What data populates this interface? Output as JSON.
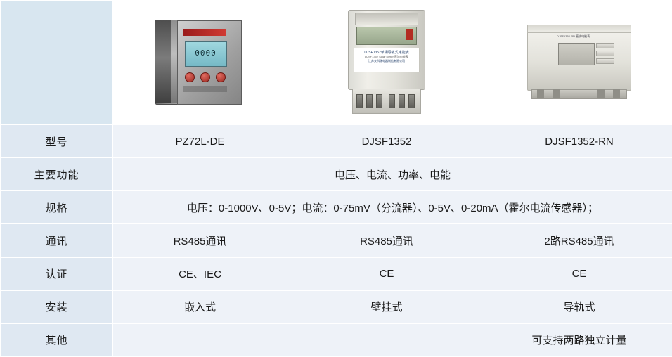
{
  "table": {
    "columns": [
      "",
      "PZ72L-DE",
      "DJSF1352",
      "DJSF1352-RN"
    ],
    "rows": [
      {
        "label": "型号",
        "cells": [
          "PZ72L-DE",
          "DJSF1352",
          "DJSF1352-RN"
        ],
        "span": false,
        "band": "a"
      },
      {
        "label": "主要功能",
        "cells": [
          "电压、电流、功率、电能"
        ],
        "span": true,
        "band": "b"
      },
      {
        "label": "规格",
        "cells": [
          "电压：0-1000V、0-5V；电流：0-75mV（分流器）、0-5V、0-20mA（霍尔电流传感器）；"
        ],
        "span": true,
        "band": "a"
      },
      {
        "label": "通讯",
        "cells": [
          "RS485通讯",
          "RS485通讯",
          "2路RS485通讯"
        ],
        "span": false,
        "band": "b"
      },
      {
        "label": "认证",
        "cells": [
          "CE、IEC",
          "CE",
          "CE"
        ],
        "span": false,
        "band": "a"
      },
      {
        "label": "安装",
        "cells": [
          "嵌入式",
          "壁挂式",
          "导轨式"
        ],
        "span": false,
        "band": "b"
      },
      {
        "label": "其他",
        "cells": [
          "",
          "",
          "可支持两路独立计量"
        ],
        "span": false,
        "band": "a"
      }
    ]
  },
  "images": {
    "device1": {
      "name": "panel-meter-photo",
      "lcd_text": "0000",
      "alt": "PZ72L-DE 嵌入式面板表"
    },
    "device2": {
      "name": "wall-mount-meter-photo",
      "label_line1": "DJSF1352单相导轨式电能表",
      "label_line2": "DJSF1352 Solar Meter 直流电能表",
      "label_line3": "江苏安科瑞电器制造有限公司",
      "alt": "DJSF1352 壁挂式直流电能表"
    },
    "device3": {
      "name": "din-rail-meter-photo",
      "label_text": "DJSF1352-RN 直流电能表",
      "alt": "DJSF1352-RN 导轨式直流电能表"
    }
  },
  "colors": {
    "band_a": "#dfe8f2",
    "band_b": "#eef2f8",
    "header_tint": "#d8e6f0",
    "text": "#1a1a1a",
    "grid": "#ffffff"
  }
}
